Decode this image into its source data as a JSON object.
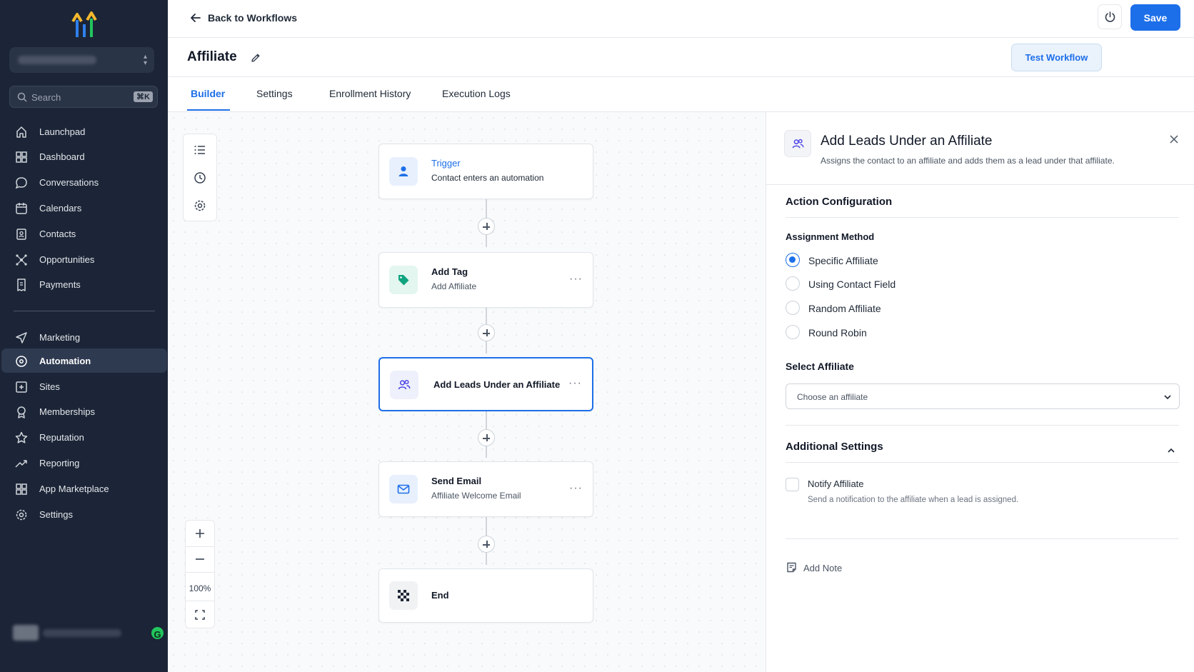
{
  "topbar": {
    "back_label": "Back to Workflows",
    "save_label": "Save"
  },
  "workflow": {
    "title": "Affiliate",
    "test_label": "Test Workflow"
  },
  "tabs": [
    {
      "label": "Builder"
    },
    {
      "label": "Settings"
    },
    {
      "label": "Enrollment History"
    },
    {
      "label": "Execution Logs"
    }
  ],
  "sidebar": {
    "search_placeholder": "Search",
    "search_shortcut": "⌘K",
    "items": [
      {
        "label": "Launchpad",
        "icon": "rocket-icon"
      },
      {
        "label": "Dashboard",
        "icon": "grid-icon"
      },
      {
        "label": "Conversations",
        "icon": "chat-bubble-icon"
      },
      {
        "label": "Calendars",
        "icon": "calendar-icon"
      },
      {
        "label": "Contacts",
        "icon": "contact-book-icon"
      },
      {
        "label": "Opportunities",
        "icon": "funnel-nodes-icon"
      },
      {
        "label": "Payments",
        "icon": "receipt-icon"
      },
      {
        "label": "Marketing",
        "icon": "send-icon"
      },
      {
        "label": "Automation",
        "icon": "automation-icon",
        "active": true
      },
      {
        "label": "Sites",
        "icon": "globe-icon"
      },
      {
        "label": "Memberships",
        "icon": "badge-icon"
      },
      {
        "label": "Reputation",
        "icon": "star-icon"
      },
      {
        "label": "Reporting",
        "icon": "trend-icon"
      },
      {
        "label": "App Marketplace",
        "icon": "apps-icon"
      },
      {
        "label": "Settings",
        "icon": "gear-icon"
      }
    ],
    "user_badge": "G"
  },
  "canvas": {
    "zoom": "100%",
    "nodes": [
      {
        "title": "Trigger",
        "subtitle": "Contact enters an automation",
        "icon": "person-icon"
      },
      {
        "title": "Add Tag",
        "subtitle": "Add Affiliate",
        "icon": "tag-icon"
      },
      {
        "title": "Add Leads Under an Affiliate",
        "subtitle": "",
        "icon": "users-icon",
        "selected": true
      },
      {
        "title": "Send Email",
        "subtitle": "Affiliate Welcome Email",
        "icon": "mail-icon"
      },
      {
        "title": "End",
        "subtitle": "",
        "icon": "checkered-flag-icon"
      }
    ]
  },
  "panel": {
    "title": "Add Leads Under an Affiliate",
    "description": "Assigns the contact to an affiliate and adds them as a lead under that affiliate.",
    "action_config_title": "Action Configuration",
    "assignment_label": "Assignment Method",
    "assignment_options": [
      {
        "label": "Specific Affiliate",
        "checked": true
      },
      {
        "label": "Using Contact Field",
        "checked": false
      },
      {
        "label": "Random Affiliate",
        "checked": false
      },
      {
        "label": "Round Robin",
        "checked": false
      }
    ],
    "select_label": "Select Affiliate",
    "select_placeholder": "Choose an affiliate",
    "additional_title": "Additional Settings",
    "notify_label": "Notify Affiliate",
    "notify_help": "Send a notification to the affiliate when a lead is assigned.",
    "notify_checked": false,
    "add_note_label": "Add Note"
  },
  "colors": {
    "accent": "#1d6fe9",
    "sidebar_bg": "#1b2537",
    "tag_green": "#10a37f"
  }
}
